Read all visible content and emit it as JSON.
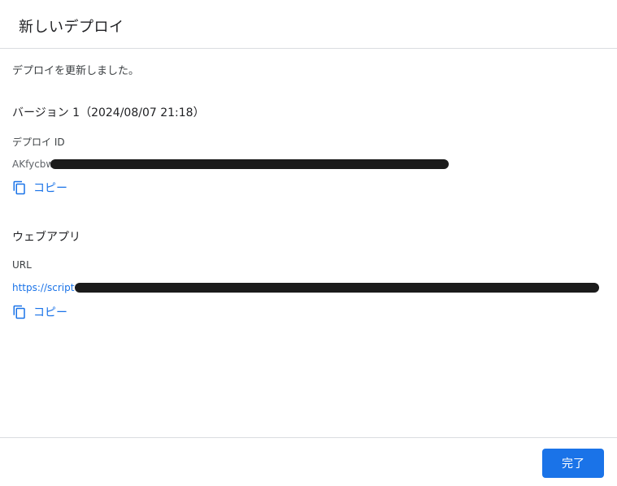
{
  "dialog": {
    "title": "新しいデプロイ",
    "message": "デプロイを更新しました。",
    "version_label": "バージョン 1（2024/08/07 21:18）",
    "deploy_id": {
      "label": "デプロイ ID",
      "value_visible": "AKfycbw",
      "copy_label": "コピー"
    },
    "webapp": {
      "heading": "ウェブアプリ",
      "url_label": "URL",
      "url_visible": "https://script",
      "copy_label": "コピー"
    },
    "done_button": "完了"
  },
  "colors": {
    "accent": "#1a73e8",
    "divider": "#dadce0",
    "redaction": "#1b1b1b"
  },
  "icons": {
    "copy": "copy-icon"
  }
}
